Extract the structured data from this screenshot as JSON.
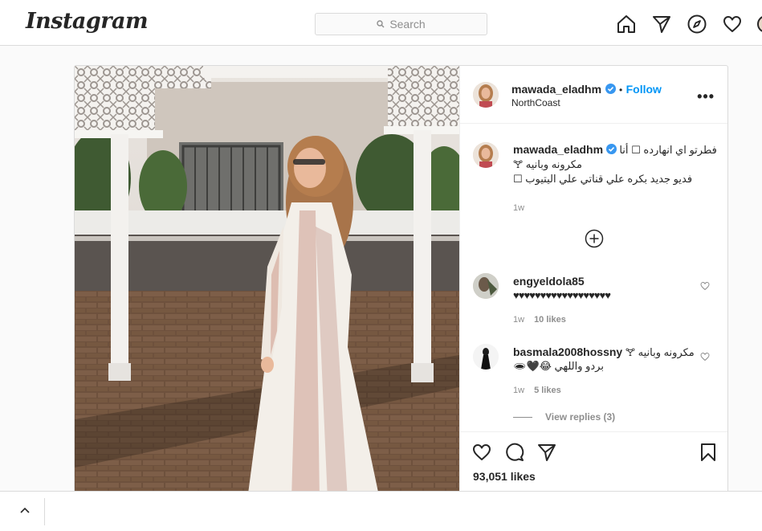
{
  "nav": {
    "logo": "Instagram",
    "search_placeholder": "Search",
    "icons": [
      "home-icon",
      "direct-icon",
      "explore-icon",
      "activity-heart-icon"
    ]
  },
  "post": {
    "author": "mawada_eladhm",
    "follow_label": "Follow",
    "separator": "•",
    "location": "NorthCoast",
    "more_label": "•••",
    "caption_author": "mawada_eladhm",
    "caption_lines": [
      "فطرتو اي انهارده ☐ أنا",
      "مكرونه وبانيه 🝖",
      "فديو جديد بكره علي قناتي علي اليتيوب ☐"
    ],
    "caption_time": "1w",
    "comments": [
      {
        "user": "engyeldola85",
        "text": "♥♥♥♥♥♥♥♥♥♥♥♥♥♥♥♥♥♥",
        "time": "1w",
        "likes": "10 likes"
      },
      {
        "user": "basmala2008hossny",
        "text": "مكرونه وبانيه 🝖",
        "text2": "بردو واللهي 😂🖤🕳",
        "time": "1w",
        "likes": "5 likes"
      }
    ],
    "view_replies": "View replies (3)",
    "likes_count": "93,051 likes"
  },
  "colors": {
    "accent": "#0095f6",
    "border": "#dbdbdb",
    "muted": "#8e8e8e"
  }
}
